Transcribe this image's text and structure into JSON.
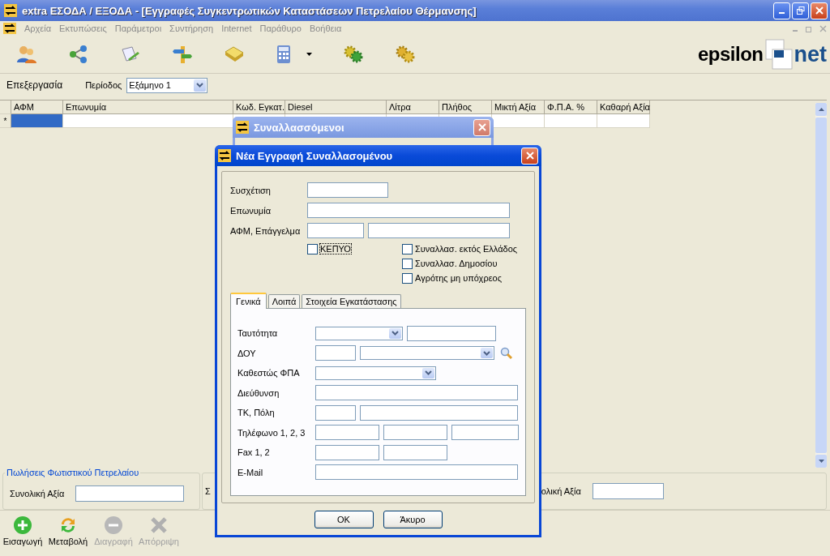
{
  "window": {
    "title": "extra ΕΣΟΔΑ / ΕΞΟΔΑ - [Εγγραφές Συγκεντρωτικών Καταστάσεων Πετρελαίου Θέρμανσης]"
  },
  "menu": [
    "Αρχεία",
    "Εκτυπώσεις",
    "Παράμετροι",
    "Συντήρηση",
    "Internet",
    "Παράθυρο",
    "Βοήθεια"
  ],
  "logo": {
    "left": "epsilon",
    "right": "net"
  },
  "view_tab": "Επεξεργασία",
  "period": {
    "label": "Περίοδος",
    "value": "Εξάμηνο 1"
  },
  "table": {
    "columns": [
      "ΑΦΜ",
      "Επωνυμία",
      "Κωδ. Εγκατ.",
      "Diesel",
      "Λίτρα",
      "Πλήθος",
      "Μικτή Αξία",
      "Φ.Π.Α. %",
      "Καθαρή Αξία"
    ],
    "new_row_marker": "*"
  },
  "summary": {
    "title": "Πωλήσεις Φωτιστικού Πετρελαίου",
    "label": "Συνολική Αξία",
    "middle_label": "Σ",
    "right_label": "ολική Αξία"
  },
  "actions": [
    {
      "label": "Εισαγωγή",
      "kind": "add",
      "disabled": false
    },
    {
      "label": "Μεταβολή",
      "kind": "refresh",
      "disabled": false
    },
    {
      "label": "Διαγραφή",
      "kind": "remove",
      "disabled": true
    },
    {
      "label": "Απόρριψη",
      "kind": "discard",
      "disabled": true
    }
  ],
  "back_dialog": {
    "title": "Συναλλασσόμενοι"
  },
  "dialog": {
    "title": "Νέα Εγγραφή Συναλλασομένου",
    "fields": [
      {
        "label": "Συσχέτιση",
        "inputs": [
          {
            "kind": "text"
          }
        ]
      },
      {
        "label": "Επωνυμία",
        "inputs": [
          {
            "kind": "text"
          }
        ]
      },
      {
        "label": "ΑΦΜ, Επάγγελμα",
        "inputs": [
          {
            "kind": "text"
          },
          {
            "kind": "text"
          }
        ]
      }
    ],
    "left_checks": [
      {
        "label": "ΚΕΠΥΟ",
        "checked": false,
        "focused": true
      }
    ],
    "right_checks": [
      {
        "label": "Συναλλασ. εκτός Ελλάδος",
        "checked": false,
        "focused": false
      },
      {
        "label": "Συναλλασ. Δημοσίου",
        "checked": false,
        "focused": false
      },
      {
        "label": "Αγρότης μη υπόχρεος",
        "checked": false,
        "focused": false
      }
    ],
    "tabs": [
      {
        "label": "Γενικά",
        "selected": true
      },
      {
        "label": "Λοιπά",
        "selected": false
      },
      {
        "label": "Στοιχεία Εγκατάστασης",
        "selected": false
      }
    ],
    "tab_rows": [
      {
        "label": "Ταυτότητα",
        "inputs": [
          {
            "kind": "combo"
          },
          {
            "kind": "text"
          }
        ]
      },
      {
        "label": "ΔΟΥ",
        "inputs": [
          {
            "kind": "text"
          },
          {
            "kind": "combo"
          },
          {
            "kind": "lookup"
          }
        ]
      },
      {
        "label": "Καθεστώς ΦΠΑ",
        "inputs": [
          {
            "kind": "combo"
          }
        ]
      },
      {
        "label": "Διεύθυνση",
        "inputs": [
          {
            "kind": "text"
          }
        ]
      },
      {
        "label": "ΤΚ, Πόλη",
        "inputs": [
          {
            "kind": "text"
          },
          {
            "kind": "text"
          }
        ]
      },
      {
        "label": "Τηλέφωνο 1, 2, 3",
        "inputs": [
          {
            "kind": "text"
          },
          {
            "kind": "text"
          },
          {
            "kind": "text"
          }
        ]
      },
      {
        "label": "Fax 1, 2",
        "inputs": [
          {
            "kind": "text"
          },
          {
            "kind": "text"
          }
        ]
      },
      {
        "label": "E-Mail",
        "inputs": [
          {
            "kind": "text"
          }
        ]
      }
    ],
    "buttons": [
      "OK",
      "Άκυρο"
    ]
  }
}
